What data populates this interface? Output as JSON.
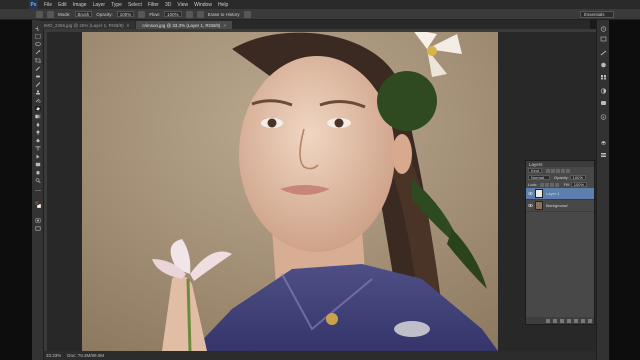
{
  "app": {
    "logo": "Ps"
  },
  "menu": [
    "File",
    "Edit",
    "Image",
    "Layer",
    "Type",
    "Select",
    "Filter",
    "3D",
    "View",
    "Window",
    "Help"
  ],
  "options": {
    "mode_label": "Mode:",
    "mode_value": "Brush",
    "opacity_label": "Opacity:",
    "opacity_value": "100%",
    "flow_label": "Flow:",
    "flow_value": "100%",
    "erase_history": "Erase to History",
    "workspace": "Essentials"
  },
  "tabs": [
    {
      "label": "IMG_2366.jpg @ 25% (Layer 1, RGB/8)",
      "close": "×"
    },
    {
      "label": "crimson.jpg @ 33.3% (Layer 1, RGB/8)",
      "close": "×"
    }
  ],
  "status": {
    "zoom": "33.33%",
    "doc": "Doc: 79.3M/89.0M"
  },
  "layers": {
    "title": "Layers",
    "kind": "Kind",
    "blend": "Normal",
    "opacity_label": "Opacity:",
    "opacity_value": "100%",
    "lock_label": "Lock:",
    "fill_label": "Fill:",
    "fill_value": "100%",
    "items": [
      {
        "name": "Layer 1",
        "active": true
      },
      {
        "name": "Background",
        "active": false
      }
    ]
  },
  "colors": {
    "accent": "#5c7fae",
    "panel": "#484848",
    "toolbar": "#333333"
  }
}
